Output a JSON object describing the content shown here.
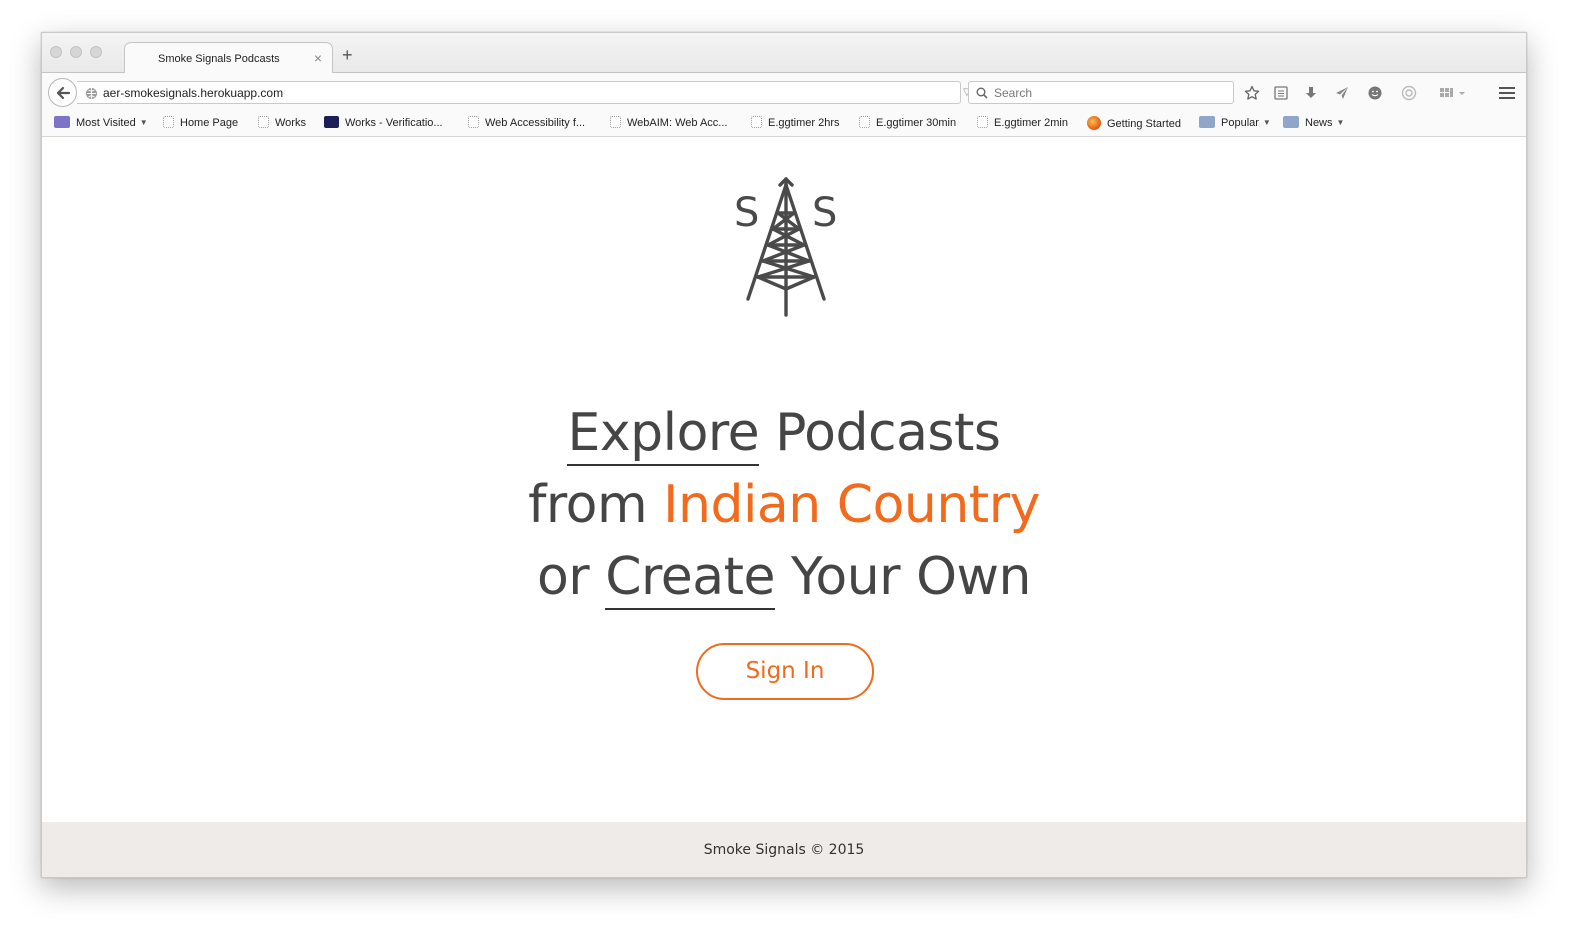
{
  "browser": {
    "tab_title": "Smoke Signals Podcasts",
    "tab_close": "×",
    "new_tab": "+",
    "url": "aer-smokesignals.herokuapp.com",
    "search_placeholder": "Search"
  },
  "bookmarks": [
    {
      "label": "Most Visited",
      "icon": "folder-icon",
      "dropdown": true
    },
    {
      "label": "Home Page",
      "icon": "page-icon"
    },
    {
      "label": "Works",
      "icon": "page-icon"
    },
    {
      "label": "Works - Verificatio...",
      "icon": "works-icon"
    },
    {
      "label": "Web Accessibility f...",
      "icon": "page-icon"
    },
    {
      "label": "WebAIM: Web Acc...",
      "icon": "page-icon"
    },
    {
      "label": "E.ggtimer 2hrs",
      "icon": "page-icon"
    },
    {
      "label": "E.ggtimer 30min",
      "icon": "page-icon"
    },
    {
      "label": "E.ggtimer 2min",
      "icon": "page-icon"
    },
    {
      "label": "Getting Started",
      "icon": "firefox-icon"
    },
    {
      "label": "Popular",
      "icon": "folder-icon",
      "dropdown": true
    },
    {
      "label": "News",
      "icon": "folder-icon",
      "dropdown": true
    }
  ],
  "logo": {
    "left_letter": "S",
    "right_letter": "S"
  },
  "hero": {
    "line1_a": "Explore",
    "line1_b": " Podcasts",
    "line2_a": "from ",
    "line2_b": "Indian Country",
    "line3_a": "or ",
    "line3_b": "Create",
    "line3_c": " Your Own"
  },
  "cta": {
    "sign_in": "Sign In"
  },
  "footer": {
    "text": "Smoke Signals © 2015"
  },
  "colors": {
    "accent": "#f26b1d",
    "text": "#454545",
    "footer_bg": "#eeebe8"
  }
}
